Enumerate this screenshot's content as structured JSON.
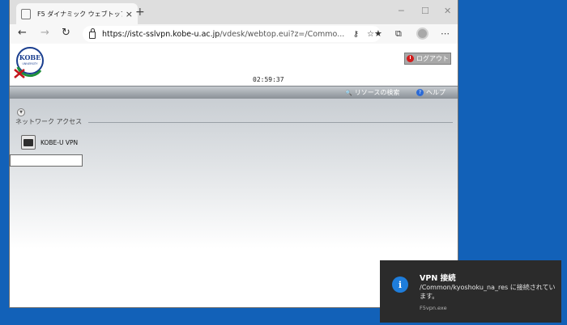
{
  "browser": {
    "tab_title": "F5 ダイナミック ウェブトップ",
    "tab_close": "×",
    "new_tab": "+",
    "url_host": "https://istc-sslvpn.kobe-u.ac.jp",
    "url_rest": "/vdesk/webtop.eui?z=/Commo...",
    "window_controls": {
      "minimize": "─",
      "maximize": "☐",
      "close": "✕"
    },
    "nav": {
      "back": "←",
      "forward": "→",
      "refresh": "↻"
    },
    "icons": {
      "key": "⚷",
      "favorite": "☆",
      "favorites_bar": "★",
      "collections": "⧉",
      "more": "⋯"
    }
  },
  "page": {
    "logout_label": "ログアウト",
    "timer": "02:59:37",
    "nav_links": {
      "search": "リソースの検索",
      "help": "ヘルプ",
      "help_glyph": "?",
      "search_glyph": "🔍"
    },
    "section": {
      "collapse_glyph": "▼",
      "title": "ネットワーク アクセス"
    },
    "resources": [
      {
        "label": "KOBE-U VPN"
      }
    ],
    "logo": {
      "text": "KOBE",
      "subtext": "UNIVERSITY"
    }
  },
  "notification": {
    "icon_glyph": "i",
    "title": "VPN 接続",
    "body": "/Common/kyoshoku_na_res に接続されています。",
    "app": "F5vpn.exe"
  },
  "colors": {
    "desktop": "#1261b8",
    "toast_background": "#2b2b2b",
    "toast_icon": "#1e7ddb",
    "logout_icon": "#d41b1b"
  }
}
